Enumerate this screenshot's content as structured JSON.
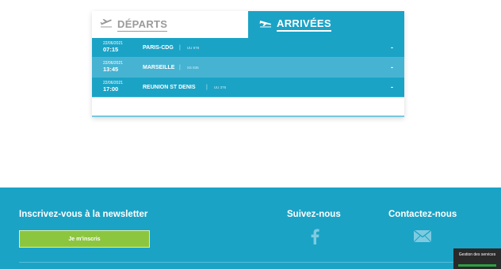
{
  "flights": {
    "tabs": {
      "departures_label": "DÉPARTS",
      "arrivals_label": "ARRIVÉES",
      "departures_icon": "plane-takeoff-icon",
      "arrivals_icon": "plane-landing-icon"
    },
    "rows": [
      {
        "date": "22/06/2021",
        "time": "07:15",
        "city": "PARIS-CDG",
        "sep": "|",
        "code": "UU 978",
        "action": "-"
      },
      {
        "date": "22/06/2021",
        "time": "13:45",
        "city": "MARSEILLE",
        "sep": "|",
        "code": "SS 836",
        "action": "-"
      },
      {
        "date": "22/06/2021",
        "time": "17:00",
        "city": "REUNION ST DENIS",
        "sep": "|",
        "code": "UU 376",
        "action": "-"
      }
    ]
  },
  "footer": {
    "newsletter_title": "Inscrivez-vous à la newsletter",
    "newsletter_button": "Je m'inscris",
    "follow_title": "Suivez-nous",
    "follow_icon": "facebook-icon",
    "contact_title": "Contactez-nous",
    "contact_icon": "mail-icon"
  },
  "cookie_widget": {
    "label": "Gestion des services"
  },
  "colors": {
    "primary": "#1ba3c6",
    "row_alt": "#46b3d2",
    "button_green": "#8cc63f",
    "tab_inactive_text": "#9a9a9a"
  }
}
